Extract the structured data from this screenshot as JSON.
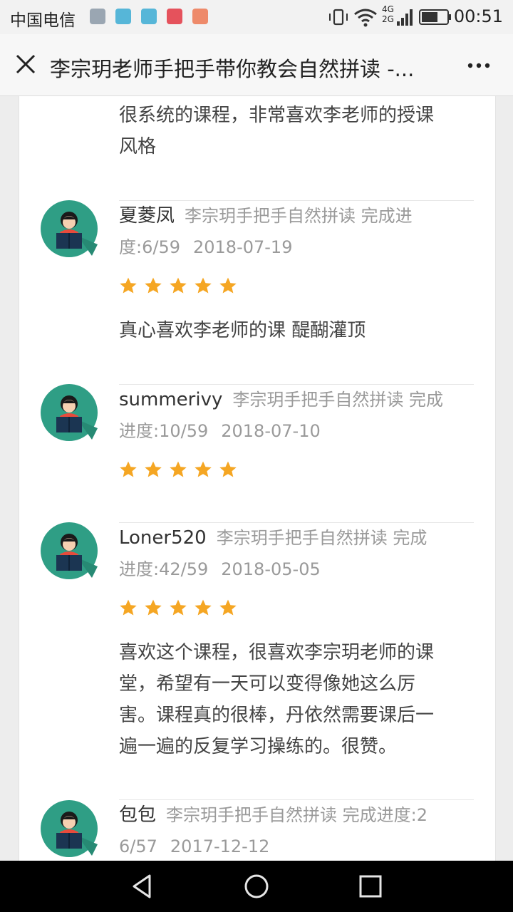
{
  "status_bar": {
    "carrier": "中国电信",
    "network": "4G 2G",
    "time": "00:51"
  },
  "header": {
    "title": "李宗玥老师手把手带你教会自然拼读 -..."
  },
  "reviews": [
    {
      "user": "",
      "course": "",
      "progress": "",
      "date": "",
      "rating": null,
      "text": [
        "很系统的课程，非常喜欢李老师的授课",
        "风格"
      ]
    },
    {
      "user": "夏菱凤",
      "meta_lines": [
        "李宗玥手把手自然拼读 完成进",
        "度:6/59"
      ],
      "date": "2018-07-19",
      "rating": 5,
      "text": [
        "真心喜欢李老师的课 醍醐灌顶"
      ]
    },
    {
      "user": "summerivy",
      "meta_lines": [
        "李宗玥手把手自然拼读 完成",
        "进度:10/59"
      ],
      "date": "2018-07-10",
      "rating": 5,
      "text": []
    },
    {
      "user": "Loner520",
      "meta_lines": [
        "李宗玥手把手自然拼读 完成",
        "进度:42/59"
      ],
      "date": "2018-05-05",
      "rating": 5,
      "text": [
        "喜欢这个课程，很喜欢李宗玥老师的课",
        "堂，希望有一天可以变得像她这么厉",
        "害。课程真的很棒，丹依然需要课后一",
        "遍一遍的反复学习操练的。很赞。"
      ]
    },
    {
      "user": "包包",
      "meta_lines": [
        "李宗玥手把手自然拼读 完成进度:2",
        "6/57"
      ],
      "date": "2017-12-12",
      "rating": null,
      "text": []
    }
  ],
  "colors": {
    "star": "#f5a623",
    "avatar_bg": "#2f9e85",
    "nav_bar": "#000000"
  },
  "icons": [
    "close-icon",
    "more-icon",
    "star-icon",
    "avatar-reader-icon",
    "back-icon",
    "home-icon",
    "recent-apps-icon"
  ]
}
